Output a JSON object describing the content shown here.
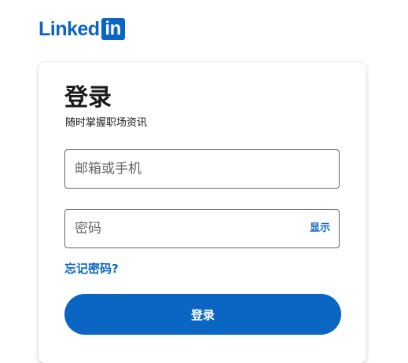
{
  "brand": {
    "logo_text": "Linked",
    "logo_box_text": "in",
    "color": "#0a66c2"
  },
  "signin": {
    "title": "登录",
    "subtitle": "随时掌握职场资讯",
    "email_placeholder": "邮箱或手机",
    "password_placeholder": "密码",
    "show_label": "显示",
    "forgot_label": "忘记密码?",
    "submit_label": "登录"
  }
}
